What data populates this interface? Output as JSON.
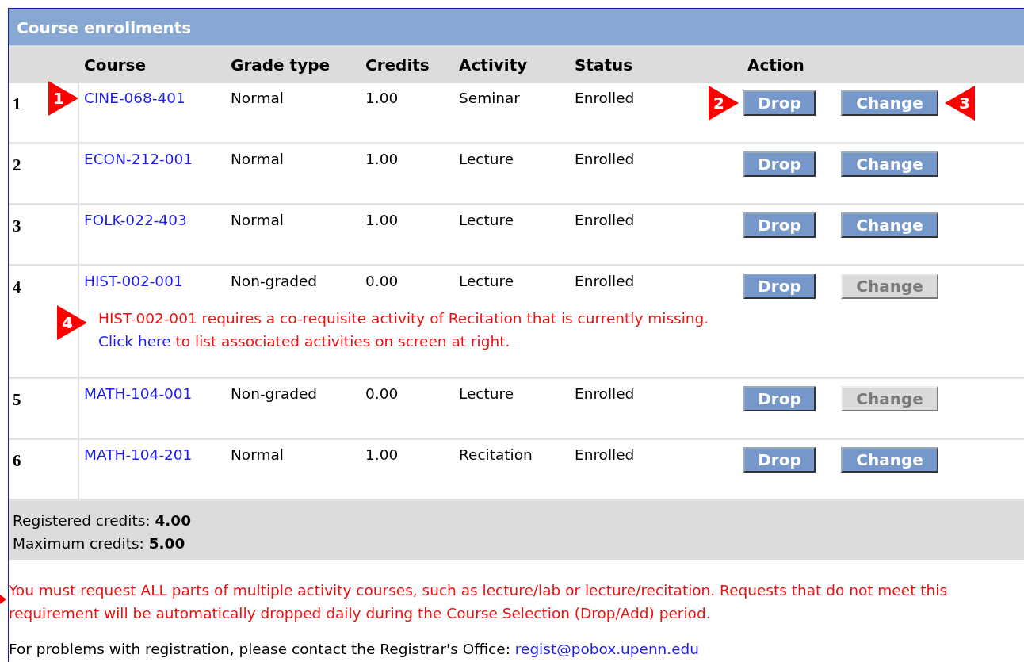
{
  "panel": {
    "title": "Course enrollments",
    "columns": [
      "Course",
      "Grade type",
      "Credits",
      "Activity",
      "Status",
      "Action"
    ],
    "rows": [
      {
        "number": "1",
        "course": "CINE-068-401",
        "course_callout": "1",
        "grade_type": "Normal",
        "credits": "1.00",
        "activity": "Seminar",
        "status": "Enrolled",
        "drop": {
          "label": "Drop",
          "disabled": false,
          "callout": "2"
        },
        "change": {
          "label": "Change",
          "disabled": false,
          "callout": "3"
        }
      },
      {
        "number": "2",
        "course": "ECON-212-001",
        "grade_type": "Normal",
        "credits": "1.00",
        "activity": "Lecture",
        "status": "Enrolled",
        "drop": {
          "label": "Drop",
          "disabled": false
        },
        "change": {
          "label": "Change",
          "disabled": false
        }
      },
      {
        "number": "3",
        "course": "FOLK-022-403",
        "grade_type": "Normal",
        "credits": "1.00",
        "activity": "Lecture",
        "status": "Enrolled",
        "drop": {
          "label": "Drop",
          "disabled": false
        },
        "change": {
          "label": "Change",
          "disabled": false
        }
      },
      {
        "number": "4",
        "course": "HIST-002-001",
        "grade_type": "Non-graded",
        "credits": "0.00",
        "activity": "Lecture",
        "status": "Enrolled",
        "drop": {
          "label": "Drop",
          "disabled": false
        },
        "change": {
          "label": "Change",
          "disabled": true
        },
        "message": {
          "callout": "4",
          "text": "HIST-002-001 requires a co-requisite activity of Recitation that is currently missing.",
          "link": "Click here",
          "rest": "to list associated activities on screen at right."
        }
      },
      {
        "number": "5",
        "course": "MATH-104-001",
        "grade_type": "Non-graded",
        "credits": "0.00",
        "activity": "Lecture",
        "status": "Enrolled",
        "drop": {
          "label": "Drop",
          "disabled": false
        },
        "change": {
          "label": "Change",
          "disabled": true
        }
      },
      {
        "number": "6",
        "course": "MATH-104-201",
        "grade_type": "Normal",
        "credits": "1.00",
        "activity": "Recitation",
        "status": "Enrolled",
        "drop": {
          "label": "Drop",
          "disabled": false
        },
        "change": {
          "label": "Change",
          "disabled": false
        }
      }
    ],
    "totals": [
      {
        "label": "Registered credits:",
        "value": "4.00"
      },
      {
        "label": "Maximum credits:",
        "value": "5.00"
      }
    ]
  },
  "warning": "You must request ALL parts of multiple activity courses, such as lecture/lab or lecture/recitation. Requests that do not meet this requirement will be automatically dropped daily during the Course Selection (Drop/Add) period.",
  "contact": {
    "text": "For problems with registration, please contact the Registrar's Office:",
    "email": "regist@pobox.upenn.edu"
  }
}
